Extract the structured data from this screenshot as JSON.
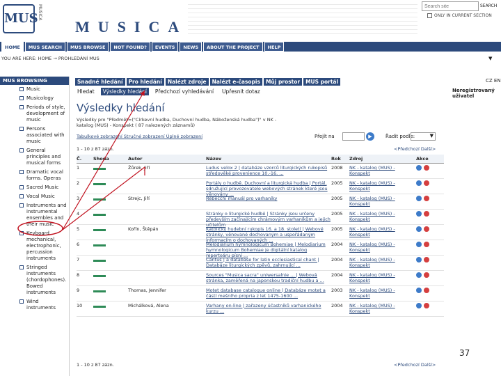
{
  "header": {
    "logo_text": "MUS",
    "vertical_text": "MUSICA",
    "brand": "MUSICA",
    "search_placeholder": "Search site",
    "search_button": "SEARCH",
    "only_check": "ONLY IN CURRENT SECTION"
  },
  "topnav": [
    "HOME",
    "MUS SEARCH",
    "MUS BROWSE",
    "NOT FOUND?",
    "EVENTS",
    "NEWS",
    "ABOUT THE PROJECT",
    "HELP"
  ],
  "breadcrumb": "YOU ARE HERE: HOME → PROHLEDÁNÍ MUS",
  "left": {
    "heading": "MUS BROWSING",
    "items": [
      "Music",
      "Musicology",
      "Periods of style, development of music",
      "Persons associated with music",
      "General principles and musical forms",
      "Dramatic vocal forms. Operas",
      "Sacred Music",
      "Vocal Music",
      "Instruments and instrumental ensembles and their music",
      "Keyboard, mechanical, electrophonic, percussion instruments",
      "Stringed instruments (chordophones). Bowed instruments",
      "Wind instruments"
    ]
  },
  "tabs1": [
    "Snadné hledání",
    "Pro hledání",
    "Nalézt zdroje",
    "Nalézt e-časopis",
    "Můj prostor",
    "MUS portál"
  ],
  "tabs2": [
    "Hledat",
    "Výsledky hledání",
    "Předchozí vyhledávání",
    "Upřesnit dotaz"
  ],
  "user": {
    "status": "Neregistrovaný uživatel",
    "flags": "CZ EN"
  },
  "content": {
    "title": "Výsledky hledání",
    "query": "Výsledky pro \"Předmět=(\"Církevní hudba, Duchovní hudba, Náboženská hudba\")\" v NK - katalog (MUS) - Konspekt ( 87 nalezených záznamů)",
    "view_links": "Tabulkové zobrazení  Stručné zobrazení  Úplné zobrazení",
    "pager_label": "Přejít na",
    "pager_go": "▶",
    "sort_label": "Řadit podle:",
    "sort_value": "▼",
    "count": "1 - 10 z 87 zázn.",
    "prev_next": "<Předchozí  Další>",
    "table": {
      "headers": [
        "Č.",
        "Shoda",
        "Autor",
        "Název",
        "Rok",
        "Zdroj",
        "Akce"
      ],
      "rows": [
        {
          "no": "1",
          "author": "Žůrek, Jiří",
          "title": "Ludus velox 2 | databáze vzorců liturgických rukopisů středověké provenience 10.-16. ...",
          "year": "2008",
          "source": "NK - katalog (MUS) - Konspekt"
        },
        {
          "no": "2",
          "author": "",
          "title": "Portály o hudbě. Duchovní a liturgická hudba | Portál, sdružující provozovatele webových stránek které jsou věnovány ...",
          "year": "2005",
          "source": "NK - katalog (MUS) - Konspekt"
        },
        {
          "no": "3",
          "author": "Strejc, Jiří",
          "title": "Rebecchi manuál pro varhaníky",
          "year": "2005",
          "source": "NK - katalog (MUS) - Konspekt"
        },
        {
          "no": "4",
          "author": "",
          "title": "Stránky o liturgické hudbě | Stránky jsou určeny především začínajícím chrámovým varhaníkům a jejich učitelům",
          "year": "2005",
          "source": "NK - katalog (MUS) - Konspekt"
        },
        {
          "no": "5",
          "author": "Kořín, Štěpán",
          "title": "Katolický hudební rukopis 16. a 18. století | Webové stránky, věnované dochovaným a uspořádaným informacím o dochovaných ...",
          "year": "2005",
          "source": "NK - katalog (MUS) - Konspekt"
        },
        {
          "no": "6",
          "author": "",
          "title": "Melodiarium hymnologicum Bohemiae | Melodiarium hymnologicum Bohemiae je digitální katalog repertoáru písní ...",
          "year": "2004",
          "source": "NK - katalog (MUS) - Konspekt"
        },
        {
          "no": "7",
          "author": "",
          "title": "Cantus | a database for latin ecclesiastical chant | Databáze liturgických zpěvů, zahrnující ...",
          "year": "2004",
          "source": "NK - katalog (MUS) - Konspekt"
        },
        {
          "no": "8",
          "author": "",
          "title": "Sources \"Musica sacra\" uniwersalnie ... | Webová stránka, zaměřená na japonskou tradiční hudbu a ...",
          "year": "2004",
          "source": "NK - katalog (MUS) - Konspekt"
        },
        {
          "no": "9",
          "author": "Thomas, Jennifer",
          "title": "Motet database catalogue online | Databáze motet a částí mešního propria z let 1475-1600 ...",
          "year": "2003",
          "source": "NK - katalog (MUS) - Konspekt"
        },
        {
          "no": "10",
          "author": "Michálková, Alena",
          "title": "Varhany on-line | zařazeny účastníků varhanického kurzu ...",
          "year": "2004",
          "source": "NK - katalog (MUS) - Konspekt"
        }
      ]
    },
    "slide_no": "37"
  }
}
